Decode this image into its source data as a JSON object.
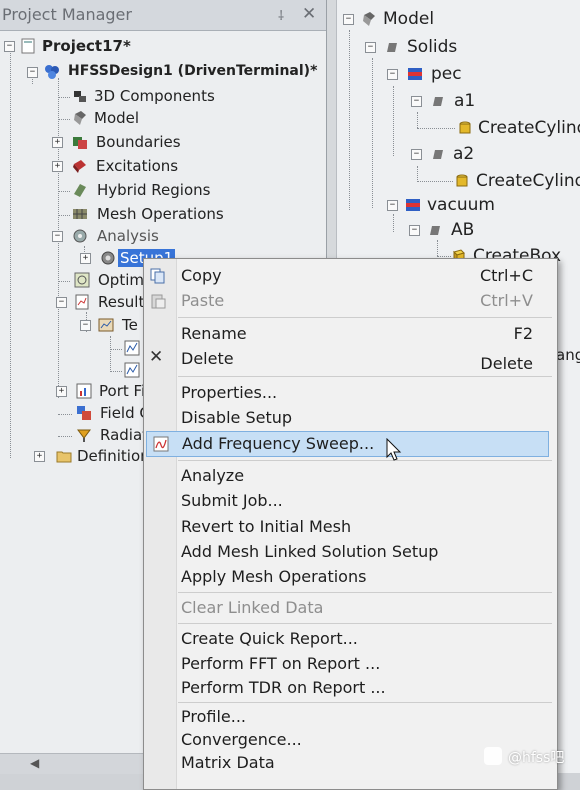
{
  "project_manager": {
    "title": "Project Manager",
    "pin_glyph": "⸸",
    "close_glyph": "✕",
    "tree": {
      "project": "Project17*",
      "design": "HFSSDesign1 (DrivenTerminal)*",
      "items": [
        {
          "label": "3D Components",
          "icon": "components-icon"
        },
        {
          "label": "Model",
          "icon": "model-icon"
        },
        {
          "label": "Boundaries",
          "icon": "boundaries-icon"
        },
        {
          "label": "Excitations",
          "icon": "excitations-icon"
        },
        {
          "label": "Hybrid Regions",
          "icon": "hybrid-regions-icon"
        },
        {
          "label": "Mesh Operations",
          "icon": "mesh-operations-icon"
        },
        {
          "label": "Analysis",
          "icon": "analysis-icon"
        },
        {
          "label": "Setup1",
          "icon": "setup-icon"
        },
        {
          "label": "Optime",
          "icon": "optimetrics-icon"
        },
        {
          "label": "Results",
          "icon": "results-icon"
        },
        {
          "label": "Te",
          "icon": "report-icon"
        },
        {
          "label": "Port Fi",
          "icon": "port-field-icon"
        },
        {
          "label": "Field C",
          "icon": "field-calculator-icon"
        },
        {
          "label": "Radiati",
          "icon": "radiation-icon"
        },
        {
          "label": "Definitions",
          "icon": "folder-icon"
        }
      ]
    }
  },
  "model_tree": {
    "items": [
      {
        "label": "Model"
      },
      {
        "label": "Solids"
      },
      {
        "label": "pec"
      },
      {
        "label": "a1"
      },
      {
        "label": "CreateCylind"
      },
      {
        "label": "a2"
      },
      {
        "label": "CreateCylind"
      },
      {
        "label": "vacuum"
      },
      {
        "label": "AB"
      },
      {
        "label": "CreateBox"
      },
      {
        "label": "ang"
      }
    ]
  },
  "context_menu": {
    "items": [
      {
        "label": "Copy",
        "shortcut": "Ctrl+C",
        "icon": "copy-icon"
      },
      {
        "label": "Paste",
        "shortcut": "Ctrl+V",
        "icon": "paste-icon",
        "disabled": true
      },
      {
        "label": "Rename",
        "shortcut": "F2"
      },
      {
        "label": "Delete",
        "shortcut": "Delete",
        "icon": "delete-icon"
      },
      {
        "label": "Properties..."
      },
      {
        "label": "Disable Setup"
      },
      {
        "label": "Add Frequency Sweep...",
        "icon": "frequency-sweep-icon",
        "highlighted": true
      },
      {
        "label": "Analyze"
      },
      {
        "label": "Submit Job..."
      },
      {
        "label": "Revert to Initial Mesh"
      },
      {
        "label": "Add Mesh Linked Solution Setup"
      },
      {
        "label": "Apply Mesh Operations"
      },
      {
        "label": "Clear Linked Data",
        "disabled": true
      },
      {
        "label": "Create Quick Report..."
      },
      {
        "label": "Perform FFT on Report ..."
      },
      {
        "label": "Perform TDR on Report ..."
      },
      {
        "label": "Profile..."
      },
      {
        "label": "Convergence..."
      },
      {
        "label": "Matrix Data"
      }
    ]
  },
  "watermark": {
    "text": "@hfss吧"
  },
  "colors": {
    "highlight": "#c7dff5",
    "selection": "#3874d8"
  }
}
